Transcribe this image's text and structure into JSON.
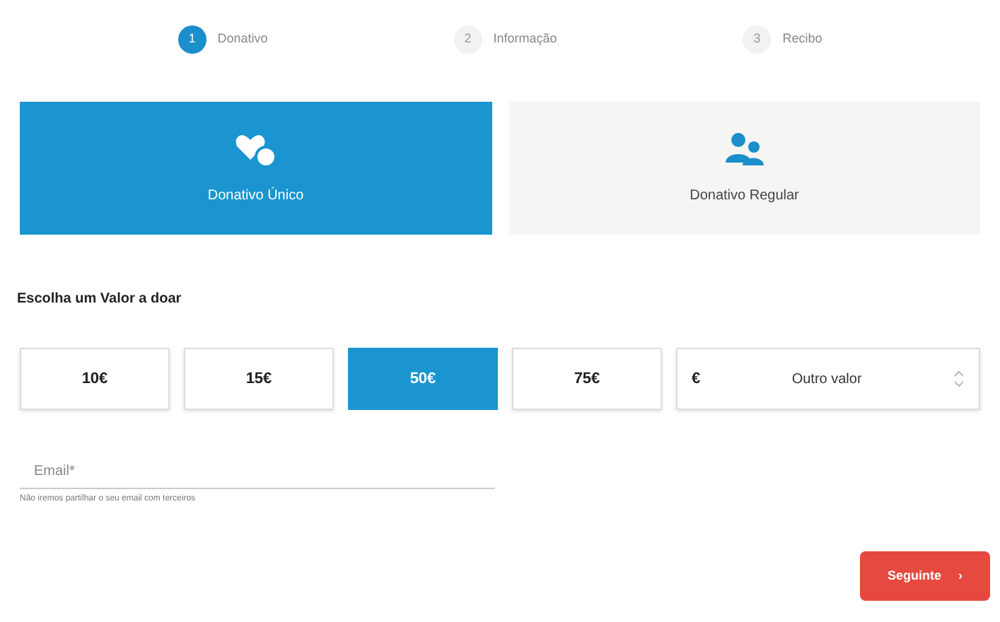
{
  "steps": [
    {
      "number": "1",
      "label": "Donativo",
      "selected": true
    },
    {
      "number": "2",
      "label": "Informação",
      "selected": false
    },
    {
      "number": "3",
      "label": "Recibo",
      "selected": false
    }
  ],
  "donation_types": [
    {
      "label": "Donativo Único",
      "kind": "single",
      "selected": true
    },
    {
      "label": "Donativo Regular",
      "kind": "regular",
      "selected": false
    }
  ],
  "amount_heading": "Escolha um Valor a doar",
  "amounts": [
    {
      "label": "10€",
      "selected": false
    },
    {
      "label": "15€",
      "selected": false
    },
    {
      "label": "50€",
      "selected": true
    },
    {
      "label": "75€",
      "selected": false
    }
  ],
  "other_amount": {
    "currency": "€",
    "placeholder": "Outro valor"
  },
  "email": {
    "placeholder": "Email*",
    "hint": "Não iremos partilhar o seu email com terceiros"
  },
  "next_button": {
    "label": "Seguinte",
    "arrow": "›"
  }
}
